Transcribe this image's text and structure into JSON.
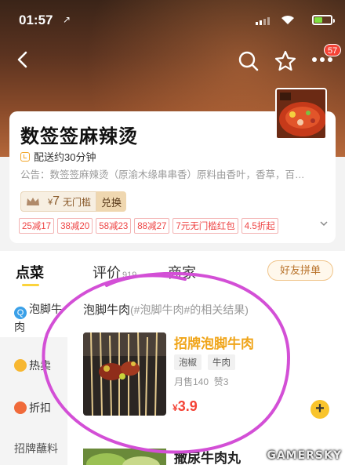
{
  "status_bar": {
    "time": "01:57",
    "location_arrow": "↗"
  },
  "nav": {
    "badge_count": "57"
  },
  "shop": {
    "name": "数签签麻辣烫",
    "delivery": "配送约30分钟",
    "notice": "公告：数签签麻辣烫（原渝木缘串串香）原料由香叶，香草，百…",
    "vip": {
      "amount_symbol": "¥",
      "amount": "7",
      "label": "无门槛",
      "redeem": "兑换"
    },
    "discount_tags": [
      "25减17",
      "38减20",
      "58减23",
      "88减27",
      "7元无门槛红包",
      "4.5折起"
    ]
  },
  "tabs": {
    "items": [
      {
        "label": "点菜",
        "count": ""
      },
      {
        "label": "评价",
        "count": "919"
      },
      {
        "label": "商家",
        "count": ""
      }
    ],
    "group_button": "好友拼单"
  },
  "sidebar": {
    "items": [
      {
        "label": "泡脚牛肉",
        "icon": "search-icon"
      },
      {
        "label": "热卖",
        "icon": "fire-icon"
      },
      {
        "label": "折扣",
        "icon": "discount-icon"
      },
      {
        "label": "招牌蘸料",
        "icon": ""
      }
    ]
  },
  "content": {
    "section_title": "泡脚牛肉",
    "section_hint": "(#泡脚牛肉#的相关结果)",
    "dishes": [
      {
        "name": "招牌泡脚牛肉",
        "tags": [
          "泡椒",
          "牛肉"
        ],
        "sales": "月售140",
        "likes": "赞3",
        "price_symbol": "¥",
        "price": "3.9"
      },
      {
        "name": "撒尿牛肉丸"
      }
    ]
  },
  "watermark": "GAMERSKY",
  "colors": {
    "accent_yellow": "#f9c42c",
    "price_red": "#f44336",
    "dish_highlight": "#f0a51a",
    "annotation": "#d34fd6"
  }
}
